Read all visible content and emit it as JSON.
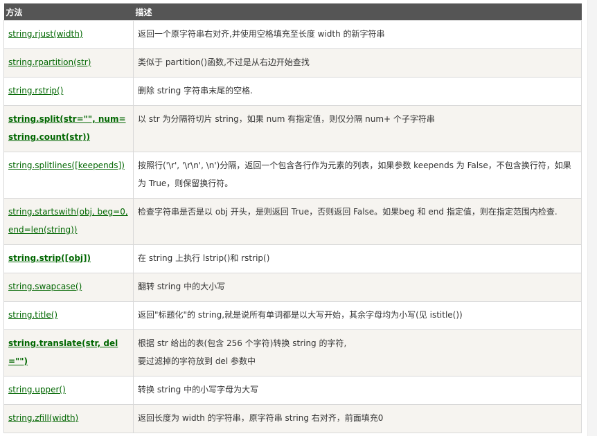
{
  "table": {
    "headers": {
      "method": "方法",
      "description": "描述"
    },
    "rows": [
      {
        "method": "string.rjust(width)",
        "bold": false,
        "desc": [
          "返回一个原字符串右对齐,并使用空格填充至长度 width 的新字符串"
        ]
      },
      {
        "method": "string.rpartition(str)",
        "bold": false,
        "desc": [
          "类似于 partition()函数,不过是从右边开始查找"
        ]
      },
      {
        "method": "string.rstrip()",
        "bold": false,
        "desc": [
          "删除 string 字符串末尾的空格."
        ]
      },
      {
        "method": "string.split(str=\"\", num=string.count(str))",
        "bold": true,
        "desc": [
          "以 str 为分隔符切片 string，如果 num 有指定值，则仅分隔 num+ 个子字符串"
        ]
      },
      {
        "method": "string.splitlines([keepends])",
        "bold": false,
        "desc": [
          "按照行('\\r', '\\r\\n', \\n')分隔，返回一个包含各行作为元素的列表，如果参数 keepends 为 False，不包含换行符，如果为 True，则保留换行符。"
        ]
      },
      {
        "method": "string.startswith(obj, beg=0,end=len(string))",
        "bold": false,
        "desc": [
          "检查字符串是否是以 obj 开头，是则返回 True，否则返回 False。如果beg 和 end 指定值，则在指定范围内检查."
        ]
      },
      {
        "method": "string.strip([obj])",
        "bold": true,
        "desc": [
          "在 string 上执行 lstrip()和 rstrip()"
        ]
      },
      {
        "method": "string.swapcase()",
        "bold": false,
        "desc": [
          "翻转 string 中的大小写"
        ]
      },
      {
        "method": "string.title()",
        "bold": false,
        "desc": [
          "返回\"标题化\"的 string,就是说所有单词都是以大写开始，其余字母均为小写(见 istitle())"
        ]
      },
      {
        "method": "string.translate(str, del=\"\")",
        "bold": true,
        "desc": [
          "根据 str 给出的表(包含 256 个字符)转换 string 的字符,",
          "要过滤掉的字符放到 del 参数中"
        ]
      },
      {
        "method": "string.upper()",
        "bold": false,
        "desc": [
          "转换 string 中的小写字母为大写"
        ]
      },
      {
        "method": "string.zfill(width)",
        "bold": false,
        "desc": [
          "返回长度为 width 的字符串，原字符串 string 右对齐，前面填充0"
        ]
      }
    ]
  }
}
